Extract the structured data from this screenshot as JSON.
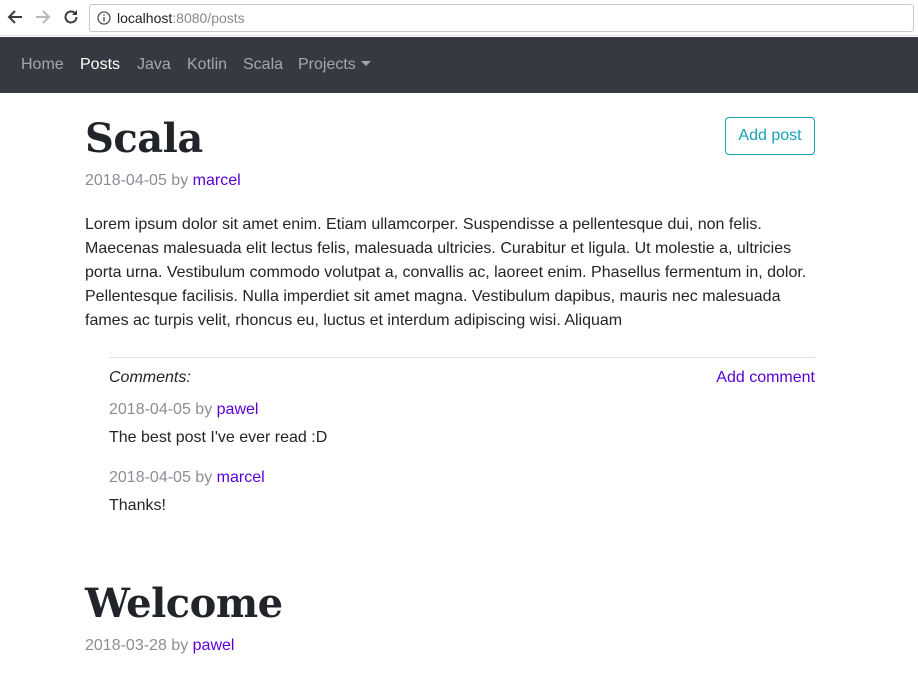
{
  "browser": {
    "url_host": "localhost",
    "url_rest": ":8080/posts"
  },
  "navbar": {
    "items": [
      {
        "label": "Home"
      },
      {
        "label": "Posts"
      },
      {
        "label": "Java"
      },
      {
        "label": "Kotlin"
      },
      {
        "label": "Scala"
      },
      {
        "label": "Projects"
      }
    ],
    "active": "Posts"
  },
  "posts": [
    {
      "title": "Scala",
      "date": "2018-04-05",
      "by": "by",
      "author": "marcel",
      "body": "Lorem ipsum dolor sit amet enim. Etiam ullamcorper. Suspendisse a pellentesque dui, non felis. Maecenas malesuada elit lectus felis, malesuada ultricies. Curabitur et ligula. Ut molestie a, ultricies porta urna. Vestibulum commodo volutpat a, convallis ac, laoreet enim. Phasellus fermentum in, dolor. Pellentesque facilisis. Nulla imperdiet sit amet magna. Vestibulum dapibus, mauris nec malesuada fames ac turpis velit, rhoncus eu, luctus et interdum adipiscing wisi. Aliquam",
      "comments_label": "Comments:",
      "add_comment_label": "Add comment",
      "comments": [
        {
          "date": "2018-04-05",
          "by": "by",
          "author": "pawel",
          "text": "The best post I've ever read :D"
        },
        {
          "date": "2018-04-05",
          "by": "by",
          "author": "marcel",
          "text": "Thanks!"
        }
      ]
    },
    {
      "title": "Welcome",
      "date": "2018-03-28",
      "by": "by",
      "author": "pawel"
    }
  ],
  "add_post_label": "Add post",
  "colors": {
    "navbar_bg": "#343a40",
    "link": "#5a00d6",
    "info_button": "#17a2b8"
  }
}
